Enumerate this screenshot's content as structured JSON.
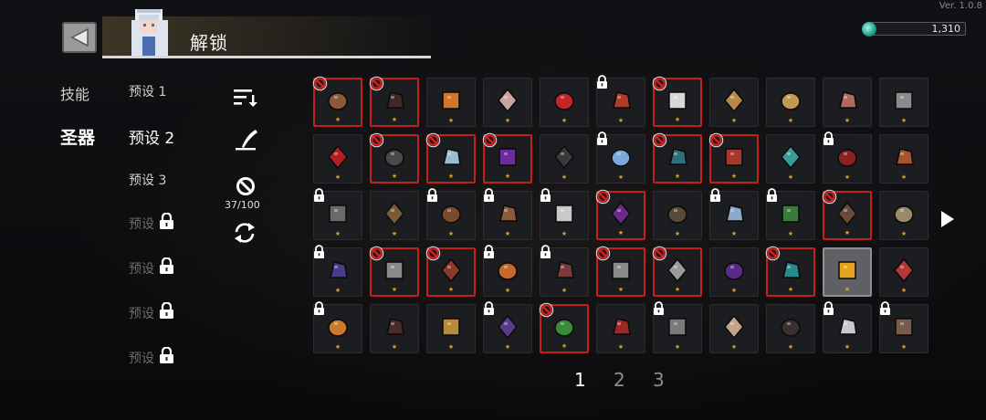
{
  "version": "Ver. 1.0.8",
  "header": {
    "title": "解锁",
    "back_icon": "back-arrow-icon"
  },
  "currency": {
    "value": "1,310",
    "icon": "gem-icon",
    "color": "#2fc4a9"
  },
  "categories": [
    {
      "label": "技能",
      "selected": false
    },
    {
      "label": "圣器",
      "selected": true
    }
  ],
  "presets": [
    {
      "label": "预设 1",
      "locked": false,
      "selected": false
    },
    {
      "label": "预设 2",
      "locked": false,
      "selected": true
    },
    {
      "label": "预设 3",
      "locked": false,
      "selected": false
    },
    {
      "label": "预设",
      "locked": true
    },
    {
      "label": "预设",
      "locked": true
    },
    {
      "label": "预设",
      "locked": true
    },
    {
      "label": "预设",
      "locked": true
    }
  ],
  "tools": {
    "sort_icon": "sort-icon",
    "quill_icon": "quill-icon",
    "ban_icon": "ban-icon",
    "ban_count": "37/100",
    "refresh_icon": "refresh-icon"
  },
  "colors": {
    "ban_red": "#c21f1f",
    "star": "#e0a020",
    "cell_bg": "#1c1d20"
  },
  "items": [
    {
      "name": "pie",
      "state": "banned",
      "color": "#8a5a3a"
    },
    {
      "name": "dark-orb",
      "state": "banned",
      "color": "#3b2a26"
    },
    {
      "name": "amber-crystal",
      "state": "normal",
      "color": "#d2742a"
    },
    {
      "name": "feather",
      "state": "normal",
      "color": "#c9a4a0"
    },
    {
      "name": "red-potion",
      "state": "normal",
      "color": "#c3262a"
    },
    {
      "name": "fox-mask",
      "state": "locked",
      "color": "#b03a2a"
    },
    {
      "name": "skull",
      "state": "banned",
      "color": "#d8d8d8"
    },
    {
      "name": "scroll",
      "state": "normal",
      "color": "#b8894a"
    },
    {
      "name": "map",
      "state": "normal",
      "color": "#c09a55"
    },
    {
      "name": "meat",
      "state": "normal",
      "color": "#b06a5a"
    },
    {
      "name": "gender-symbol",
      "state": "normal",
      "color": "#8a8a8a"
    },
    {
      "name": "red-bat",
      "state": "normal",
      "color": "#b02020"
    },
    {
      "name": "coffin",
      "state": "banned",
      "color": "#4a4a4a"
    },
    {
      "name": "ice-shard",
      "state": "banned",
      "color": "#9bbcd0"
    },
    {
      "name": "purple-gem",
      "state": "banned",
      "color": "#6a2a9a"
    },
    {
      "name": "black-stone",
      "state": "normal",
      "color": "#3a3a3a"
    },
    {
      "name": "frost-ore",
      "state": "locked",
      "color": "#7aa8d8"
    },
    {
      "name": "teal-tree",
      "state": "banned",
      "color": "#2f6f78"
    },
    {
      "name": "mushroom",
      "state": "banned",
      "color": "#a33a2a"
    },
    {
      "name": "teal-rings",
      "state": "normal",
      "color": "#3a9a96"
    },
    {
      "name": "red-scarf",
      "state": "locked",
      "color": "#8a2222"
    },
    {
      "name": "clay-vase",
      "state": "normal",
      "color": "#a4552e"
    },
    {
      "name": "spoon",
      "state": "locked",
      "color": "#6a6a6a"
    },
    {
      "name": "boomerang",
      "state": "normal",
      "color": "#7a5a38"
    },
    {
      "name": "wood-planks",
      "state": "locked",
      "color": "#7a4a2e"
    },
    {
      "name": "wood-board",
      "state": "locked",
      "color": "#8a5a3a"
    },
    {
      "name": "snow-globe",
      "state": "locked",
      "color": "#c9c9c9"
    },
    {
      "name": "purple-lantern",
      "state": "banned",
      "color": "#6a2a8a"
    },
    {
      "name": "book-stand",
      "state": "normal",
      "color": "#5a4a3a"
    },
    {
      "name": "blue-rock",
      "state": "locked",
      "color": "#8aaac8"
    },
    {
      "name": "green-wreath",
      "state": "locked",
      "color": "#3a7a3a"
    },
    {
      "name": "rifle",
      "state": "banned",
      "color": "#6a4a3a"
    },
    {
      "name": "fish-skull",
      "state": "normal",
      "color": "#9a8a6a"
    },
    {
      "name": "dark-staff",
      "state": "locked",
      "color": "#4a3a8a"
    },
    {
      "name": "crossed-swords",
      "state": "banned",
      "color": "#8a8a8a"
    },
    {
      "name": "red-shield",
      "state": "banned",
      "color": "#8a3a2a"
    },
    {
      "name": "blue-orange-block",
      "state": "locked",
      "color": "#c56a2a"
    },
    {
      "name": "red-wing",
      "state": "locked",
      "color": "#7a3a3a"
    },
    {
      "name": "dagger",
      "state": "banned",
      "color": "#8a8a8a"
    },
    {
      "name": "knife",
      "state": "banned",
      "color": "#9a9a9a"
    },
    {
      "name": "purple-orb",
      "state": "normal",
      "color": "#5a2a8a"
    },
    {
      "name": "teal-mech",
      "state": "banned",
      "color": "#2a8a8a"
    },
    {
      "name": "gold-bars",
      "state": "selected",
      "color": "#e4a420"
    },
    {
      "name": "red-boot",
      "state": "normal",
      "color": "#b03a3a"
    },
    {
      "name": "orange-coin",
      "state": "locked",
      "color": "#c97a2a"
    },
    {
      "name": "dark-spider",
      "state": "normal",
      "color": "#4a2a2a"
    },
    {
      "name": "gold-mask",
      "state": "normal",
      "color": "#b88a3a"
    },
    {
      "name": "purple-hood",
      "state": "locked",
      "color": "#5a3a8a"
    },
    {
      "name": "green-clover",
      "state": "banned",
      "color": "#3a8a3a"
    },
    {
      "name": "red-wings",
      "state": "normal",
      "color": "#9a2a2a"
    },
    {
      "name": "helmet",
      "state": "locked",
      "color": "#7a7a7a"
    },
    {
      "name": "fang",
      "state": "normal",
      "color": "#c4a488"
    },
    {
      "name": "dark-ring",
      "state": "normal",
      "color": "#3a3030"
    },
    {
      "name": "white-pearl",
      "state": "locked",
      "color": "#c8c8d0"
    },
    {
      "name": "pebble",
      "state": "locked",
      "color": "#7a5a4a"
    }
  ],
  "pagination": {
    "pages": [
      "1",
      "2",
      "3"
    ],
    "current": "1",
    "next_icon": "next-arrow-icon"
  }
}
